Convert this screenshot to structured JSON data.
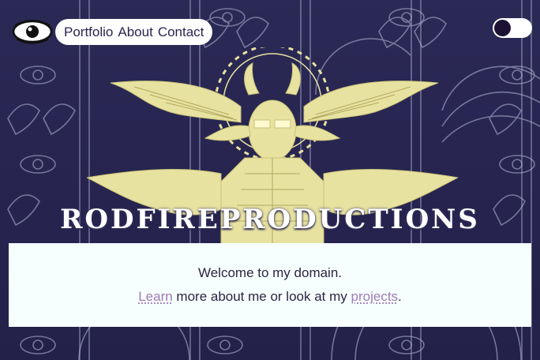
{
  "nav": {
    "logo_icon": "eye-logo-icon",
    "links": [
      "Portfolio",
      "About",
      "Contact"
    ]
  },
  "theme_toggle": {
    "state": "dark"
  },
  "hero": {
    "title": "RODFIREPRODUCTIONS",
    "illustration": "winged-horned-figure-with-halo"
  },
  "welcome": {
    "line1": "Welcome to my domain.",
    "learn_link": "Learn",
    "middle_text": " more about me or look at my ",
    "projects_link": "projects",
    "end_text": "."
  },
  "colors": {
    "background": "#26244a",
    "illustration": "#e8e2a0",
    "card_bg": "#f6fffe",
    "link": "#a079b8",
    "nav_text": "#2a2450",
    "toggle_knob": "#1e1234"
  }
}
